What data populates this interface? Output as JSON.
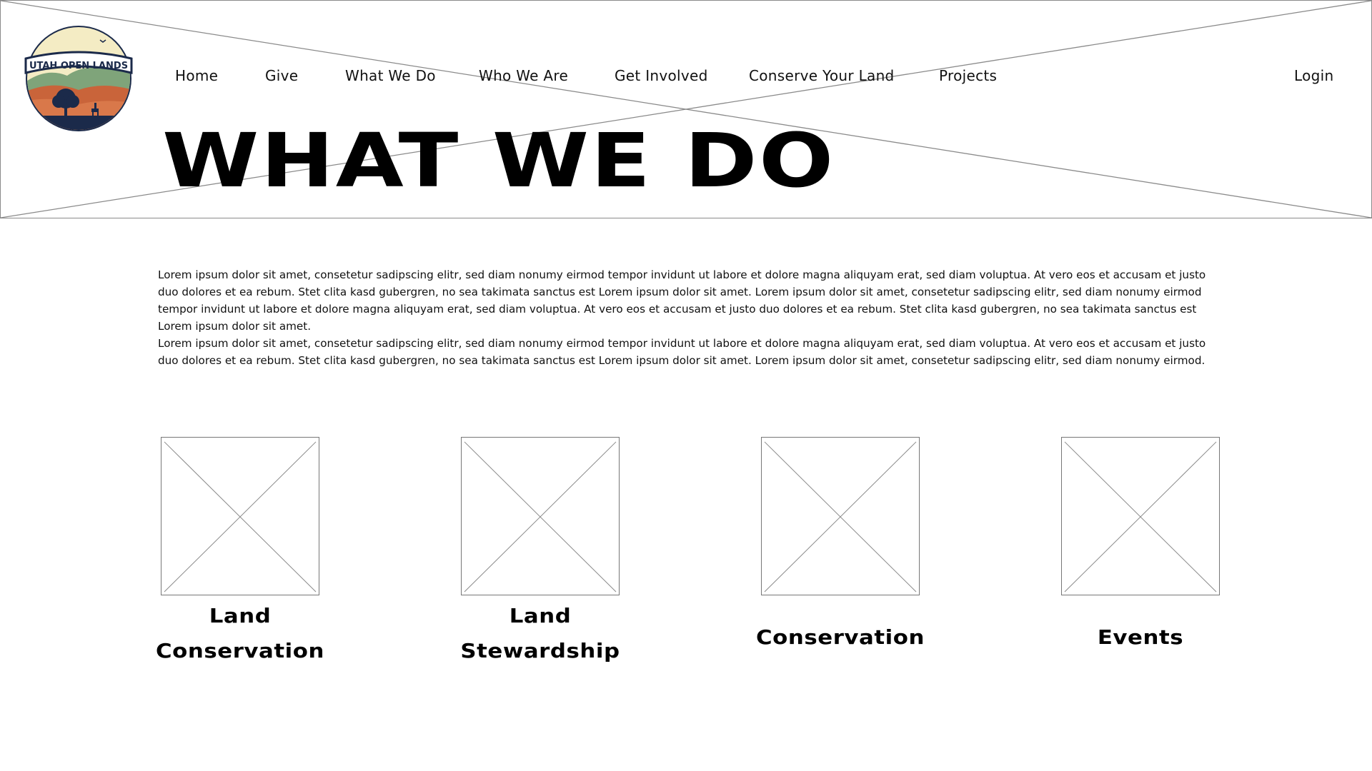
{
  "brand": {
    "logo_text": "UTAH OPEN LANDS"
  },
  "nav": {
    "items": [
      {
        "label": "Home"
      },
      {
        "label": "Give"
      },
      {
        "label": "What We Do"
      },
      {
        "label": "Who We Are"
      },
      {
        "label": "Get Involved"
      },
      {
        "label": "Conserve Your Land"
      },
      {
        "label": "Projects"
      }
    ],
    "login": "Login"
  },
  "hero": {
    "title": "WHAT WE DO"
  },
  "intro": {
    "paragraphs": [
      "Lorem ipsum dolor sit amet, consetetur sadipscing elitr, sed diam nonumy eirmod tempor invidunt ut labore et dolore magna aliquyam erat, sed diam voluptua. At vero eos et accusam et justo duo dolores et ea rebum. Stet clita kasd gubergren, no sea takimata sanctus est Lorem ipsum dolor sit amet. Lorem ipsum dolor sit amet, consetetur sadipscing elitr, sed diam nonumy eirmod tempor invidunt ut labore et dolore magna aliquyam erat, sed diam voluptua. At vero eos et accusam et justo duo dolores et ea rebum. Stet clita kasd gubergren, no sea takimata sanctus est Lorem ipsum dolor sit amet.",
      "Lorem ipsum dolor sit amet, consetetur sadipscing elitr, sed diam nonumy eirmod tempor invidunt ut labore et dolore magna aliquyam erat, sed diam voluptua. At vero eos et accusam et justo duo dolores et ea rebum. Stet clita kasd gubergren, no sea takimata sanctus est Lorem ipsum dolor sit amet. Lorem ipsum dolor sit amet, consetetur sadipscing elitr, sed diam nonumy eirmod."
    ]
  },
  "cards": [
    {
      "line1": "Land",
      "line2": "Conservation"
    },
    {
      "line1": "Land",
      "line2": "Stewardship"
    },
    {
      "line1": "Conservation",
      "line2": ""
    },
    {
      "line1": "Events",
      "line2": ""
    }
  ],
  "colors": {
    "text": "#000000",
    "placeholder_line": "#8a8a8a",
    "logo_navy": "#1b2a4a",
    "logo_sky": "#f4ecc4",
    "logo_green": "#7fa47a",
    "logo_orange": "#c9643a"
  }
}
